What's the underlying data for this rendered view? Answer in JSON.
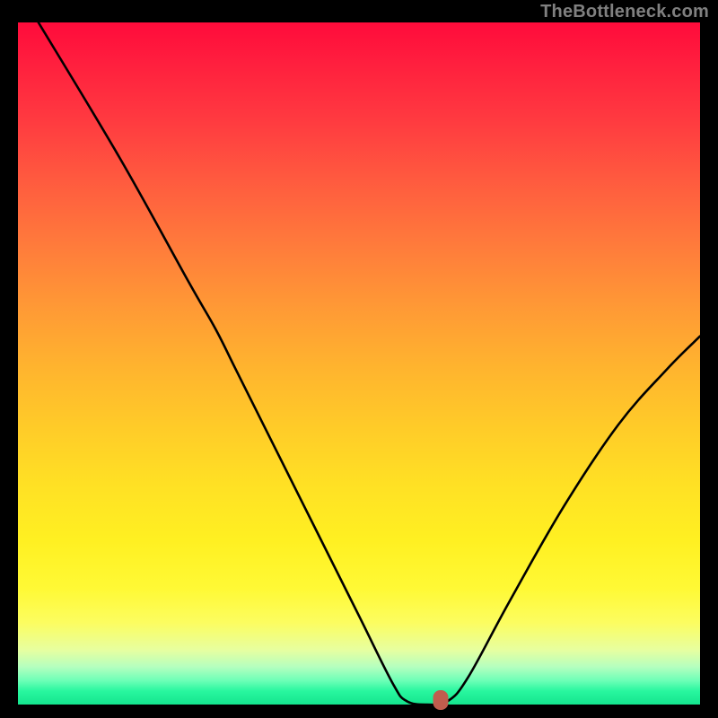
{
  "watermark": "TheBottleneck.com",
  "chart_data": {
    "type": "line",
    "title": "",
    "xlabel": "",
    "ylabel": "",
    "xlim": [
      0,
      100
    ],
    "ylim": [
      0,
      100
    ],
    "curve": {
      "name": "bottleneck-curve",
      "points": [
        {
          "x": 3,
          "y": 100
        },
        {
          "x": 15,
          "y": 80
        },
        {
          "x": 25,
          "y": 62
        },
        {
          "x": 29,
          "y": 55
        },
        {
          "x": 32,
          "y": 49
        },
        {
          "x": 38,
          "y": 37
        },
        {
          "x": 44,
          "y": 25
        },
        {
          "x": 50,
          "y": 13
        },
        {
          "x": 55,
          "y": 3
        },
        {
          "x": 57,
          "y": 0.5
        },
        {
          "x": 60,
          "y": 0
        },
        {
          "x": 63,
          "y": 0.5
        },
        {
          "x": 66,
          "y": 4
        },
        {
          "x": 72,
          "y": 15
        },
        {
          "x": 80,
          "y": 29
        },
        {
          "x": 88,
          "y": 41
        },
        {
          "x": 95,
          "y": 49
        },
        {
          "x": 100,
          "y": 54
        }
      ]
    },
    "marker": {
      "x": 62,
      "y": 0.6,
      "color": "#c15d4e"
    },
    "gradient_stops": [
      {
        "pos": 0,
        "color": "#ff0b3b"
      },
      {
        "pos": 50,
        "color": "#ffcd28"
      },
      {
        "pos": 85,
        "color": "#fcfd60"
      },
      {
        "pos": 100,
        "color": "#14e58e"
      }
    ]
  }
}
